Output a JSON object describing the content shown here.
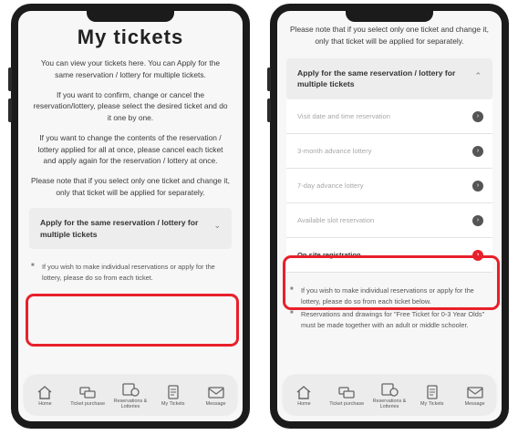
{
  "left_screen": {
    "title": "My tickets",
    "para1": "You can view your tickets here. You can Apply for the same reservation / lottery for multiple tickets.",
    "para2": "If you want to confirm, change or cancel the reservation/lottery, please select the desired ticket and do it one by one.",
    "para3": "If you want to change the contents of the reservation / lottery applied for all at once, please cancel each ticket and apply again for the reservation / lottery at once.",
    "para4": "Please note that if you select only one ticket and change it, only that ticket will be applied for separately.",
    "accordion_label": "Apply for the same reservation / lottery for multiple tickets",
    "accordion_icon": "chevron-down-icon",
    "note1": "If you wish to make individual reservations or apply for the lottery, please do so from each ticket."
  },
  "right_screen": {
    "para_top": "Please note that if you select only one ticket and change it, only that ticket will be applied for separately.",
    "accordion_label": "Apply for the same reservation / lottery for multiple tickets",
    "accordion_icon": "chevron-up-icon",
    "options": [
      {
        "label": "Visit date and time reservation",
        "state": "disabled"
      },
      {
        "label": "3-month advance lottery",
        "state": "disabled"
      },
      {
        "label": "7-day advance lottery",
        "state": "disabled"
      },
      {
        "label": "Available slot reservation",
        "state": "disabled"
      },
      {
        "label": "On site registration",
        "state": "active"
      }
    ],
    "notes": [
      "If you wish to make individual reservations or apply for the lottery, please do so from each ticket below.",
      "Reservations and drawings for \"Free Ticket for 0-3 Year Olds\" must be made together with an adult or middle schooler."
    ]
  },
  "tabbar": {
    "items": [
      {
        "label": "Home",
        "icon": "home-icon"
      },
      {
        "label": "Ticket purchase",
        "icon": "ticket-purchase-icon"
      },
      {
        "label": "Reservations & Lotteries",
        "icon": "reservations-icon"
      },
      {
        "label": "My Tickets",
        "icon": "my-tickets-icon"
      },
      {
        "label": "Message",
        "icon": "message-icon"
      }
    ]
  },
  "colors": {
    "highlight": "#e8202a",
    "accordion_bg": "#ededed",
    "screen_bg": "#f7f7f7"
  }
}
